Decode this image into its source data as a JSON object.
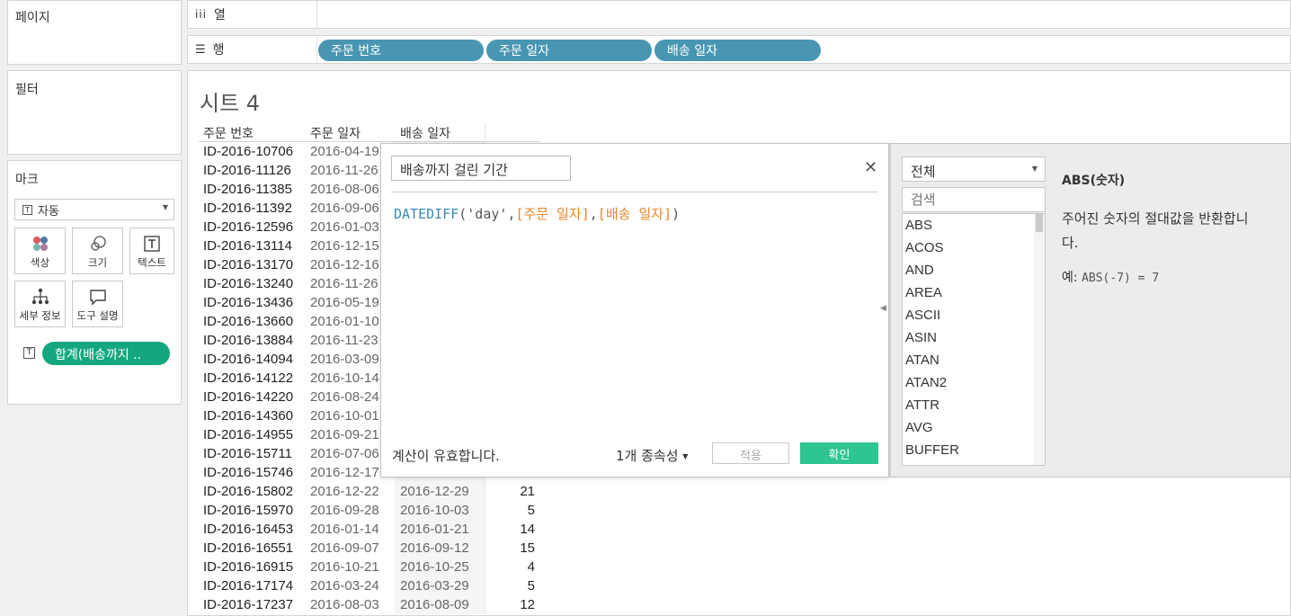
{
  "panels": {
    "pages": "페이지",
    "filters": "필터",
    "marks": "마크"
  },
  "shelves": {
    "columns_label": "열",
    "rows_label": "행",
    "row_pills": [
      "주문 번호",
      "주문 일자",
      "배송 일자"
    ]
  },
  "marks": {
    "type_value": "자동",
    "buttons": [
      "색상",
      "크기",
      "텍스트",
      "세부 정보",
      "도구 설명"
    ],
    "field_pill": "합계(배송까지 .."
  },
  "sheet": {
    "title": "시트 4",
    "headers": [
      "주문 번호",
      "주문 일자",
      "배송 일자"
    ],
    "rows": [
      {
        "id": "ID-2016-10706",
        "order": "2016-04-19",
        "ship": "",
        "days": ""
      },
      {
        "id": "ID-2016-11126",
        "order": "2016-11-26",
        "ship": "",
        "days": ""
      },
      {
        "id": "ID-2016-11385",
        "order": "2016-08-06",
        "ship": "",
        "days": ""
      },
      {
        "id": "ID-2016-11392",
        "order": "2016-09-06",
        "ship": "",
        "days": ""
      },
      {
        "id": "ID-2016-12596",
        "order": "2016-01-03",
        "ship": "",
        "days": ""
      },
      {
        "id": "ID-2016-13114",
        "order": "2016-12-15",
        "ship": "",
        "days": ""
      },
      {
        "id": "ID-2016-13170",
        "order": "2016-12-16",
        "ship": "",
        "days": ""
      },
      {
        "id": "ID-2016-13240",
        "order": "2016-11-26",
        "ship": "",
        "days": ""
      },
      {
        "id": "ID-2016-13436",
        "order": "2016-05-19",
        "ship": "",
        "days": ""
      },
      {
        "id": "ID-2016-13660",
        "order": "2016-01-10",
        "ship": "",
        "days": ""
      },
      {
        "id": "ID-2016-13884",
        "order": "2016-11-23",
        "ship": "",
        "days": ""
      },
      {
        "id": "ID-2016-14094",
        "order": "2016-03-09",
        "ship": "",
        "days": ""
      },
      {
        "id": "ID-2016-14122",
        "order": "2016-10-14",
        "ship": "",
        "days": ""
      },
      {
        "id": "ID-2016-14220",
        "order": "2016-08-24",
        "ship": "",
        "days": ""
      },
      {
        "id": "ID-2016-14360",
        "order": "2016-10-01",
        "ship": "",
        "days": ""
      },
      {
        "id": "ID-2016-14955",
        "order": "2016-09-21",
        "ship": "",
        "days": ""
      },
      {
        "id": "ID-2016-15711",
        "order": "2016-07-06",
        "ship": "",
        "days": ""
      },
      {
        "id": "ID-2016-15746",
        "order": "2016-12-17",
        "ship": "",
        "days": ""
      },
      {
        "id": "ID-2016-15802",
        "order": "2016-12-22",
        "ship": "2016-12-29",
        "days": "21"
      },
      {
        "id": "ID-2016-15970",
        "order": "2016-09-28",
        "ship": "2016-10-03",
        "days": "5"
      },
      {
        "id": "ID-2016-16453",
        "order": "2016-01-14",
        "ship": "2016-01-21",
        "days": "14"
      },
      {
        "id": "ID-2016-16551",
        "order": "2016-09-07",
        "ship": "2016-09-12",
        "days": "15"
      },
      {
        "id": "ID-2016-16915",
        "order": "2016-10-21",
        "ship": "2016-10-25",
        "days": "4"
      },
      {
        "id": "ID-2016-17174",
        "order": "2016-03-24",
        "ship": "2016-03-29",
        "days": "5"
      },
      {
        "id": "ID-2016-17237",
        "order": "2016-08-03",
        "ship": "2016-08-09",
        "days": "12"
      }
    ]
  },
  "calc": {
    "name": "배송까지 걸린 기간",
    "formula": {
      "func": "DATEDIFF",
      "open": "(",
      "str": "'day'",
      "comma1": ",",
      "field1": "[주문 일자]",
      "comma2": ",",
      "field2": "[배송 일자]",
      "close": ")"
    },
    "status": "계산이 유효합니다.",
    "dependencies": "1개 종속성",
    "apply": "적용",
    "ok": "확인"
  },
  "functions": {
    "category": "전체",
    "search_placeholder": "검색",
    "list": [
      "ABS",
      "ACOS",
      "AND",
      "AREA",
      "ASCII",
      "ASIN",
      "ATAN",
      "ATAN2",
      "ATTR",
      "AVG",
      "BUFFER"
    ],
    "help_title": "ABS(숫자)",
    "help_desc": "주어진 숫자의 절대값을 반환합니다.",
    "help_example_label": "예:",
    "help_example": "ABS(-7) = 7"
  },
  "colors": {
    "pill": "#4996b2",
    "measure_pill": "#14a77e",
    "ok_button": "#2fc493",
    "function": "#3a8ab5",
    "field": "#e8852a"
  }
}
